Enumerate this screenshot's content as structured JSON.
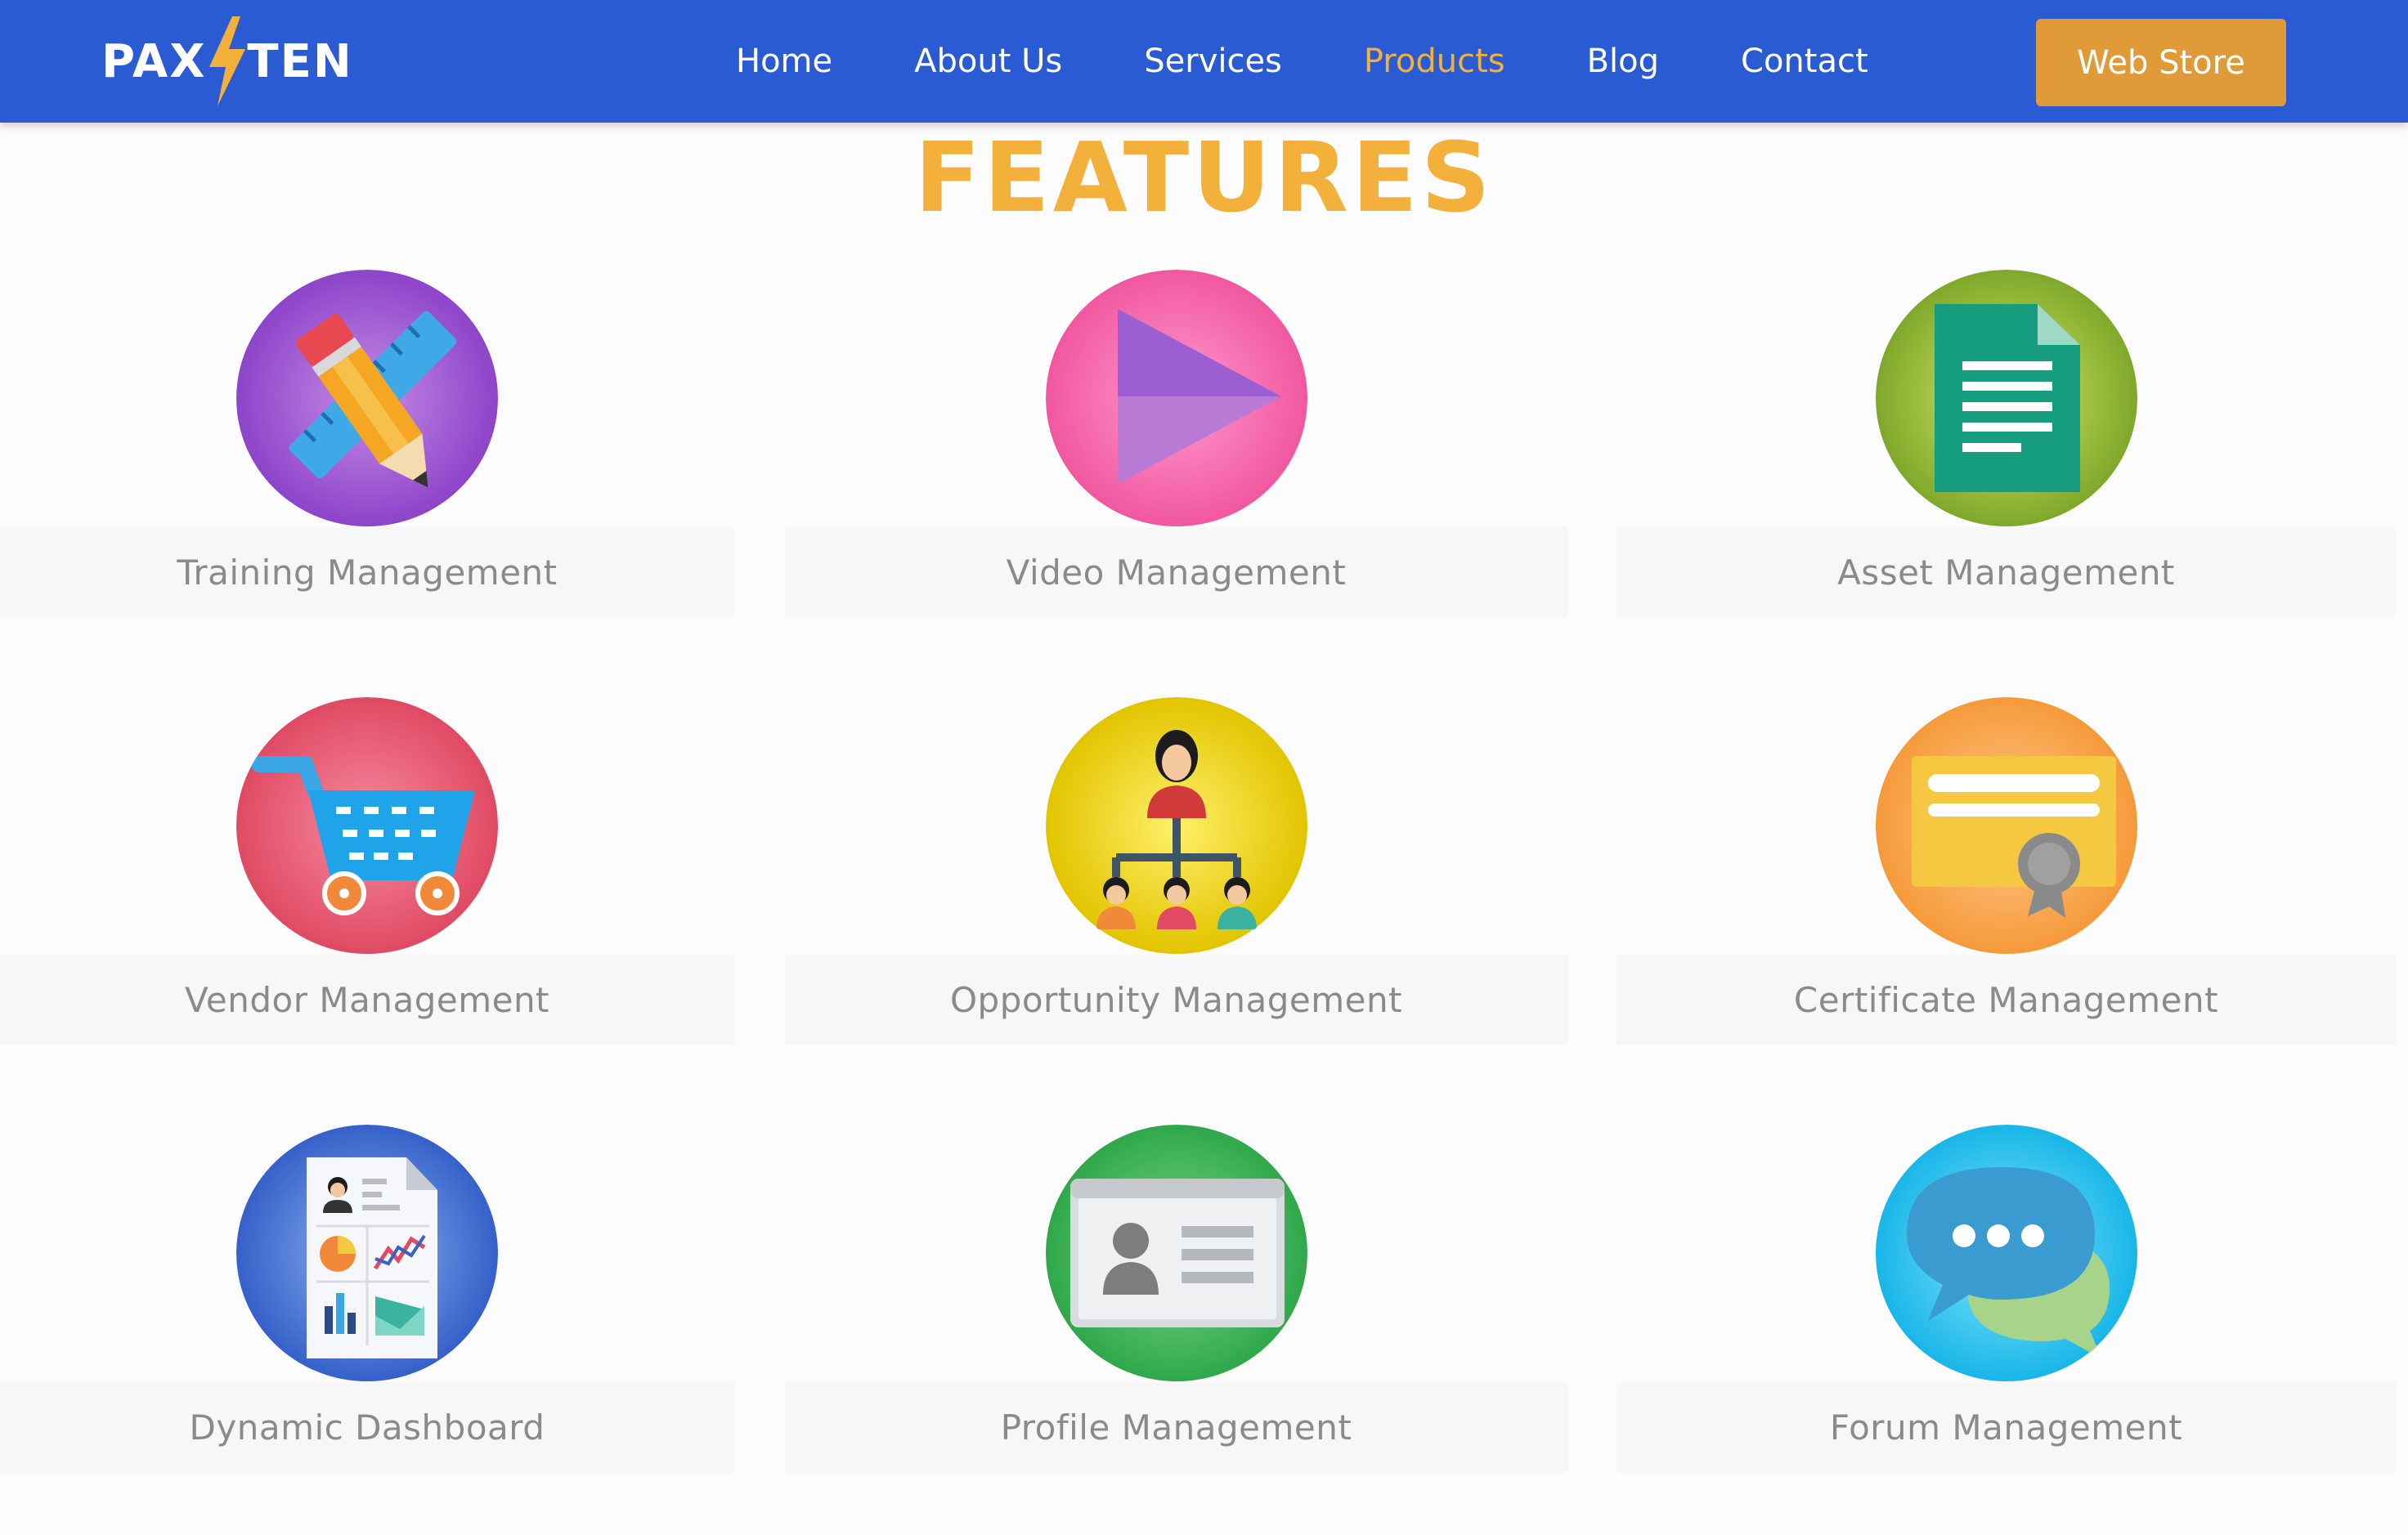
{
  "brand": {
    "logo_left": "PAX",
    "logo_right": "TEN",
    "primary_color": "#2b5bd3",
    "accent_color": "#f3b13b",
    "button_color": "#e09b38"
  },
  "nav": {
    "items": [
      {
        "label": "Home",
        "active": false
      },
      {
        "label": "About Us",
        "active": false
      },
      {
        "label": "Services",
        "active": false
      },
      {
        "label": "Products",
        "active": true
      },
      {
        "label": "Blog",
        "active": false
      },
      {
        "label": "Contact",
        "active": false
      }
    ],
    "web_store_label": "Web Store"
  },
  "section": {
    "title": "FEATURES"
  },
  "features": [
    {
      "label": "Training Management",
      "icon": "pencil-ruler-icon"
    },
    {
      "label": "Video Management",
      "icon": "play-icon"
    },
    {
      "label": "Asset Management",
      "icon": "document-icon"
    },
    {
      "label": "Vendor Management",
      "icon": "shopping-cart-icon"
    },
    {
      "label": "Opportunity Management",
      "icon": "org-chart-icon"
    },
    {
      "label": "Certificate Management",
      "icon": "certificate-icon"
    },
    {
      "label": "Dynamic Dashboard",
      "icon": "dashboard-report-icon"
    },
    {
      "label": "Profile Management",
      "icon": "id-card-icon"
    },
    {
      "label": "Forum Management",
      "icon": "chat-bubbles-icon"
    }
  ]
}
